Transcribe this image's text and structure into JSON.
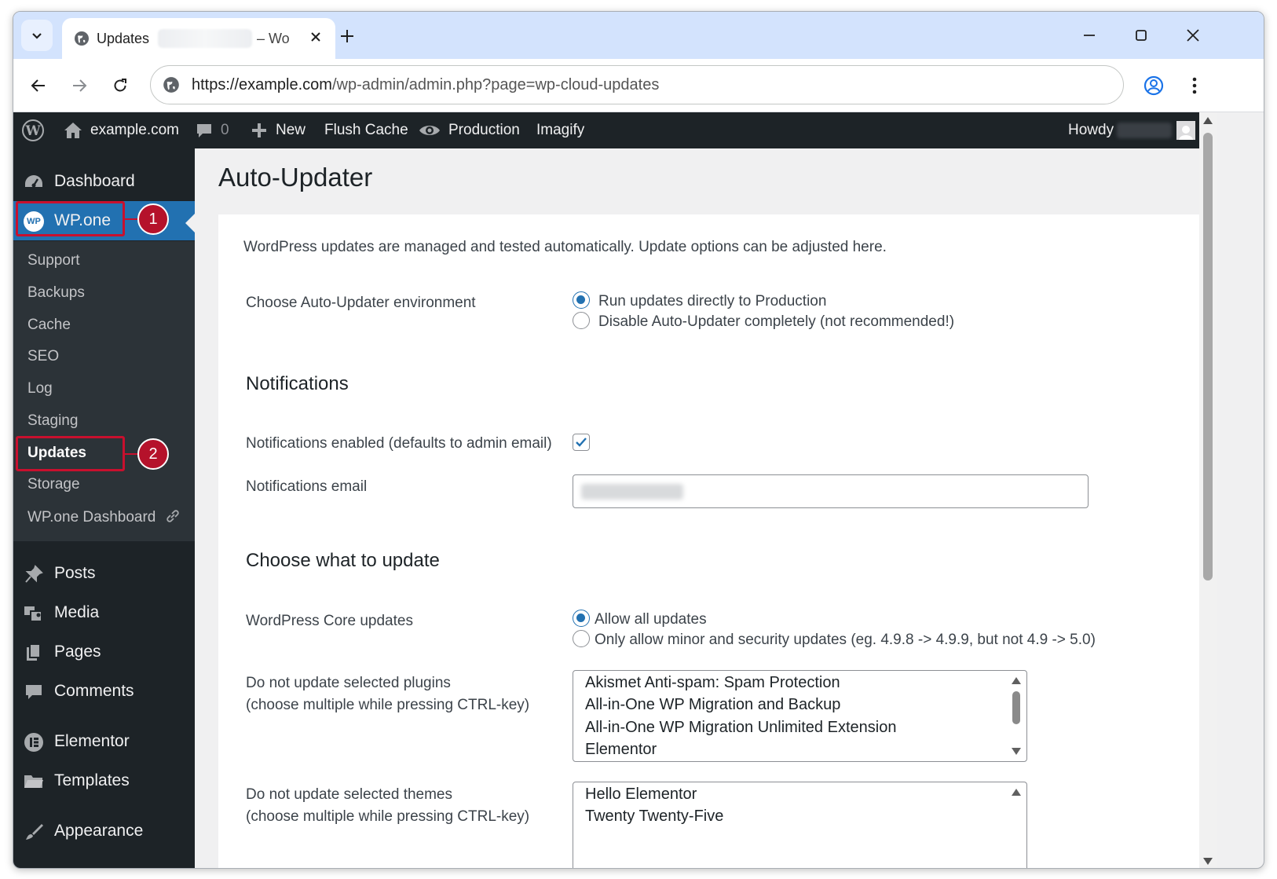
{
  "browser": {
    "tab_title": "Updates",
    "tab_title_suffix": "– Wo",
    "url_host": "https://example.com",
    "url_path": "/wp-admin/admin.php?page=wp-cloud-updates"
  },
  "adminbar": {
    "site_name": "example.com",
    "comments_count": "0",
    "new_label": "New",
    "flush_cache_label": "Flush Cache",
    "production_label": "Production",
    "imagify_label": "Imagify",
    "howdy_label": "Howdy"
  },
  "sidebar": {
    "dashboard": "Dashboard",
    "wpone": "WP.one",
    "wpone_badge": "WP",
    "submenu": [
      "Support",
      "Backups",
      "Cache",
      "SEO",
      "Log",
      "Staging",
      "Updates",
      "Storage",
      "WP.one Dashboard"
    ],
    "posts": "Posts",
    "media": "Media",
    "pages": "Pages",
    "comments": "Comments",
    "elementor": "Elementor",
    "templates": "Templates",
    "appearance": "Appearance",
    "callout_1": "1",
    "callout_2": "2"
  },
  "main": {
    "page_title": "Auto-Updater",
    "intro": "WordPress updates are managed and tested automatically. Update options can be adjusted here.",
    "env_label": "Choose Auto-Updater environment",
    "env_options": [
      {
        "label": "Run updates directly to Production",
        "selected": true
      },
      {
        "label": "Disable Auto-Updater completely (not recommended!)",
        "selected": false
      }
    ],
    "notifications_heading": "Notifications",
    "notifications_enabled_label": "Notifications enabled (defaults to admin email)",
    "notifications_enabled": true,
    "notifications_email_label": "Notifications email",
    "choose_heading": "Choose what to update",
    "core_label": "WordPress Core updates",
    "core_options": [
      {
        "label": "Allow all updates",
        "selected": true
      },
      {
        "label": "Only allow minor and security updates (eg. 4.9.8 -> 4.9.9, but not 4.9 -> 5.0)",
        "selected": false
      }
    ],
    "plugins_label_1": "Do not update selected plugins",
    "plugins_label_2": "(choose multiple while pressing CTRL-key)",
    "plugins": [
      "Akismet Anti-spam: Spam Protection",
      "All-in-One WP Migration and Backup",
      "All-in-One WP Migration Unlimited Extension",
      "Elementor"
    ],
    "themes_label_1": "Do not update selected themes",
    "themes_label_2": "(choose multiple while pressing CTRL-key)",
    "themes": [
      "Hello Elementor",
      "Twenty Twenty-Five"
    ]
  },
  "colors": {
    "wp_dark": "#1d2327",
    "wp_blue": "#2271b1",
    "callout_red": "#c8102e",
    "chrome_tab_strip": "#d3e3fd"
  }
}
